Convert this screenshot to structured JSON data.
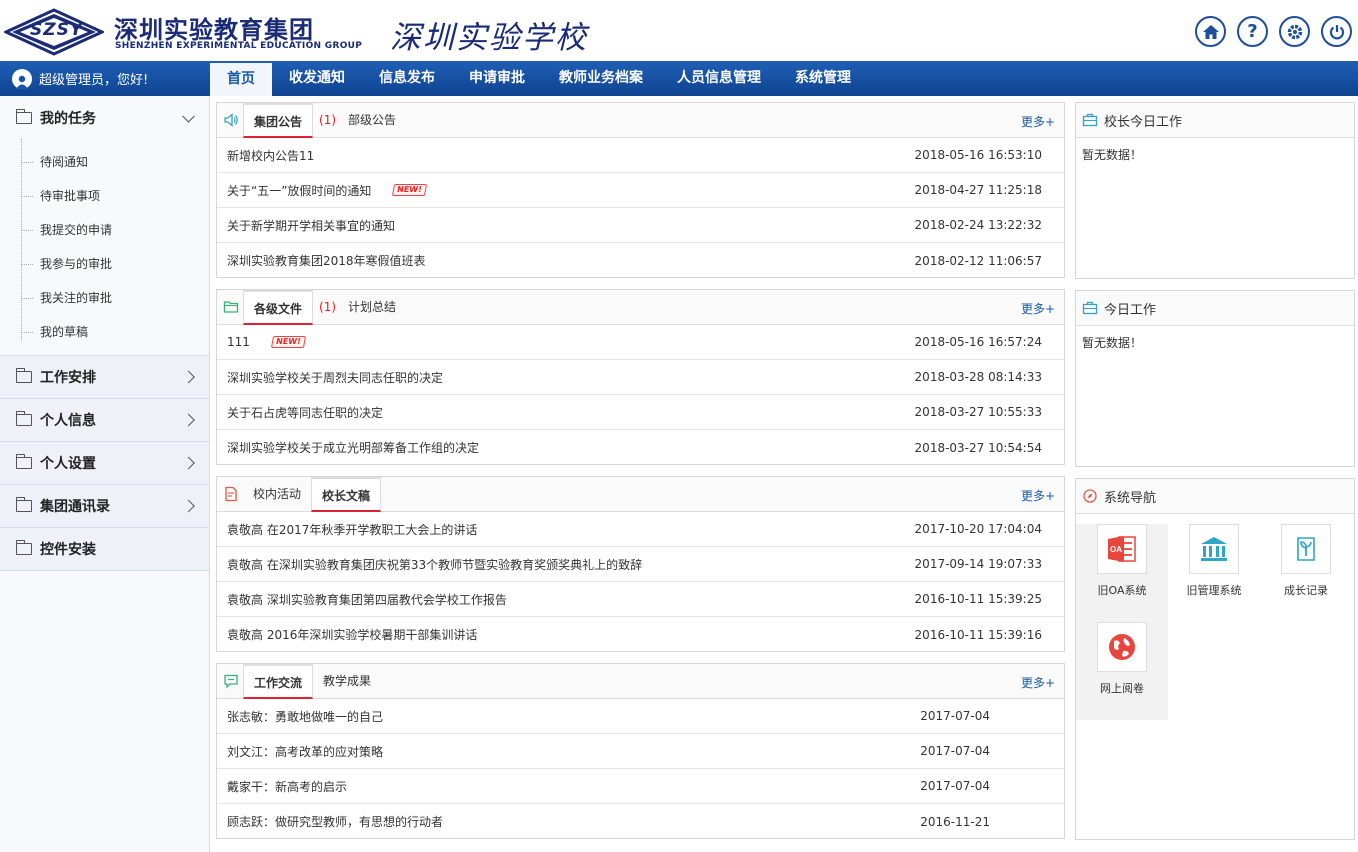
{
  "header": {
    "logo_text": "SZSY",
    "group_name": "深圳实验教育集团",
    "group_name_en": "SHENZHEN EXPERIMENTAL EDUCATION GROUP",
    "school_name": "深圳实验学校",
    "icons": [
      "home-icon",
      "help-icon",
      "gear-icon",
      "power-icon"
    ]
  },
  "navbar": {
    "welcome": "超级管理员，您好!",
    "items": [
      "首页",
      "收发通知",
      "信息发布",
      "申请审批",
      "教师业务档案",
      "人员信息管理",
      "系统管理"
    ],
    "active": "首页"
  },
  "sidebar": {
    "groups": [
      {
        "label": "我的任务",
        "expanded": true,
        "items": [
          "待阅通知",
          "待审批事项",
          "我提交的申请",
          "我参与的审批",
          "我关注的审批",
          "我的草稿"
        ]
      },
      {
        "label": "工作安排"
      },
      {
        "label": "个人信息"
      },
      {
        "label": "个人设置"
      },
      {
        "label": "集团通讯录"
      },
      {
        "label": "控件安装"
      }
    ]
  },
  "panels": {
    "announcements": {
      "tabs": [
        "集团公告",
        "部级公告"
      ],
      "count": "(1)",
      "more": "更多+",
      "rows": [
        {
          "title": "新增校内公告11",
          "date": "2018-05-16 16:53:10",
          "new": false
        },
        {
          "title": "关于“五一”放假时间的通知",
          "date": "2018-04-27 11:25:18",
          "new": true
        },
        {
          "title": "关于新学期开学相关事宜的通知",
          "date": "2018-02-24 13:22:32",
          "new": false
        },
        {
          "title": "深圳实验教育集团2018年寒假值班表",
          "date": "2018-02-12 11:06:57",
          "new": false
        }
      ]
    },
    "files": {
      "tabs": [
        "各级文件",
        "计划总结"
      ],
      "count": "(1)",
      "more": "更多+",
      "rows": [
        {
          "title": "111",
          "date": "2018-05-16 16:57:24",
          "new": true
        },
        {
          "title": "深圳实验学校关于周烈夫同志任职的决定",
          "date": "2018-03-28 08:14:33",
          "new": false
        },
        {
          "title": "关于石占虎等同志任职的决定",
          "date": "2018-03-27 10:55:33",
          "new": false
        },
        {
          "title": "深圳实验学校关于成立光明部筹备工作组的决定",
          "date": "2018-03-27 10:54:54",
          "new": false
        }
      ]
    },
    "principal": {
      "tabs": [
        "校内活动",
        "校长文稿"
      ],
      "more": "更多+",
      "rows": [
        {
          "title": "袁敬高 在2017年秋季开学教职工大会上的讲话",
          "date": "2017-10-20 17:04:04"
        },
        {
          "title": "袁敬高 在深圳实验教育集团庆祝第33个教师节暨实验教育奖颁奖典礼上的致辞",
          "date": "2017-09-14 19:07:33"
        },
        {
          "title": "袁敬高 深圳实验教育集团第四届教代会学校工作报告",
          "date": "2016-10-11 15:39:25"
        },
        {
          "title": "袁敬高 2016年深圳实验学校暑期干部集训讲话",
          "date": "2016-10-11 15:39:16"
        }
      ]
    },
    "exchange": {
      "tabs": [
        "工作交流",
        "教学成果"
      ],
      "more": "更多+",
      "rows": [
        {
          "title": "张志敏：勇敢地做唯一的自己",
          "date": "2017-07-04"
        },
        {
          "title": "刘文江：高考改革的应对策略",
          "date": "2017-07-04"
        },
        {
          "title": "戴家干：新高考的启示",
          "date": "2017-07-04"
        },
        {
          "title": "顾志跃：做研究型教师，有思想的行动者",
          "date": "2016-11-21"
        }
      ]
    },
    "principal_today": {
      "title": "校长今日工作",
      "empty": "暂无数据！"
    },
    "today": {
      "title": "今日工作",
      "empty": "暂无数据！"
    },
    "system_nav": {
      "title": "系统导航",
      "tiles": [
        {
          "label": "旧OA系统",
          "icon": "oa-icon",
          "color": "#e8453c"
        },
        {
          "label": "旧管理系统",
          "icon": "bank-icon",
          "color": "#2fa5c7"
        },
        {
          "label": "成长记录",
          "icon": "sprout-icon",
          "color": "#2fa5c7"
        },
        {
          "label": "网上阅卷",
          "icon": "globe-icon",
          "color": "#e8453c"
        }
      ]
    }
  },
  "new_badge": "NEW!",
  "colors": {
    "nav_blue": "#1653a6",
    "link_blue": "#1a5aa6",
    "red": "#dd2222"
  }
}
